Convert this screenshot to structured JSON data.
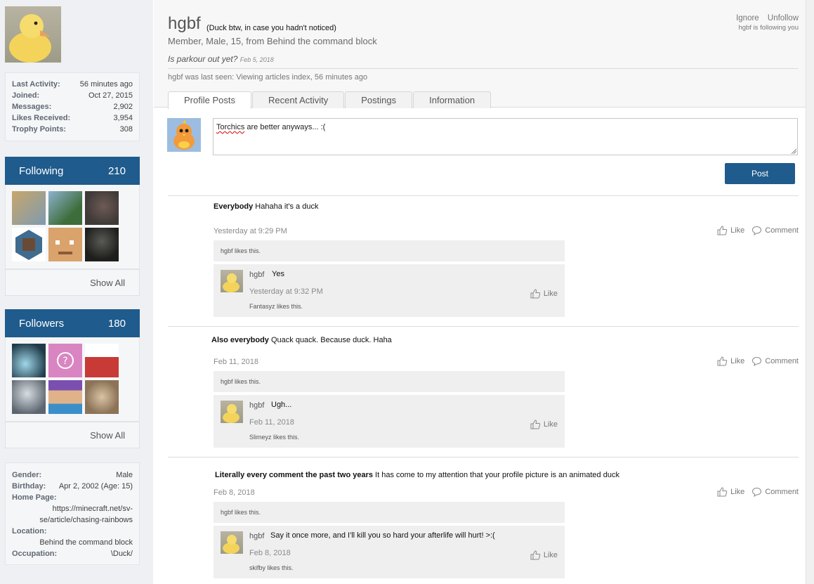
{
  "profile": {
    "username": "hgbf",
    "custom_title": "(Duck btw, in case you hadn't noticed)",
    "meta": "Member, Male, 15, from Behind the command block",
    "status": "Is parkour out yet?",
    "status_date": "Feb 5, 2018",
    "last_seen": "hgbf was last seen: Viewing articles index, 56 minutes ago",
    "actions": {
      "ignore": "Ignore",
      "unfollow": "Unfollow"
    },
    "following_note": "hgbf is following you"
  },
  "stats": [
    {
      "label": "Last Activity:",
      "value": "56 minutes ago"
    },
    {
      "label": "Joined:",
      "value": "Oct 27, 2015"
    },
    {
      "label": "Messages:",
      "value": "2,902"
    },
    {
      "label": "Likes Received:",
      "value": "3,954"
    },
    {
      "label": "Trophy Points:",
      "value": "308"
    }
  ],
  "following": {
    "title": "Following",
    "count": "210",
    "show_all": "Show All"
  },
  "followers": {
    "title": "Followers",
    "count": "180",
    "show_all": "Show All"
  },
  "info": {
    "gender_label": "Gender:",
    "gender": "Male",
    "birthday_label": "Birthday:",
    "birthday": "Apr 2, 2002 (Age: 15)",
    "homepage_label": "Home Page:",
    "homepage_1": "https://minecraft.net/sv-",
    "homepage_2": "se/article/chasing-rainbows",
    "location_label": "Location:",
    "location": "Behind the command block",
    "occupation_label": "Occupation:",
    "occupation": "\\Duck/"
  },
  "tabs": [
    "Profile Posts",
    "Recent Activity",
    "Postings",
    "Information"
  ],
  "composer": {
    "misspelled": "Torchics",
    "rest": " are better anyways... :(",
    "post_label": "Post"
  },
  "action_labels": {
    "like": "Like",
    "comment": "Comment"
  },
  "posts": [
    {
      "author": "Everybody",
      "text": " Hahaha it's a duck",
      "date": "Yesterday at 9:29 PM",
      "likes": "hgbf likes this.",
      "comment": {
        "author": "hgbf",
        "text": "Yes",
        "date": "Yesterday at 9:32 PM",
        "likes": "Fantasyz likes this."
      }
    },
    {
      "author": "Also everybody",
      "text": " Quack quack. Because duck. Haha",
      "date": "Feb 11, 2018",
      "likes": "hgbf likes this.",
      "comment": {
        "author": "hgbf",
        "text": "Ugh...",
        "date": "Feb 11, 2018",
        "likes": "Slimeyz likes this."
      }
    },
    {
      "author": "Literally every comment the past two years",
      "text": " It has come to my attention that your profile picture is an animated duck",
      "date": "Feb 8, 2018",
      "likes": "hgbf likes this.",
      "comment": {
        "author": "hgbf",
        "text": "Say it once more, and I'll kill you so hard your afterlife will hurt! >:(",
        "date": "Feb 8, 2018",
        "likes": "skifby likes this."
      }
    }
  ]
}
